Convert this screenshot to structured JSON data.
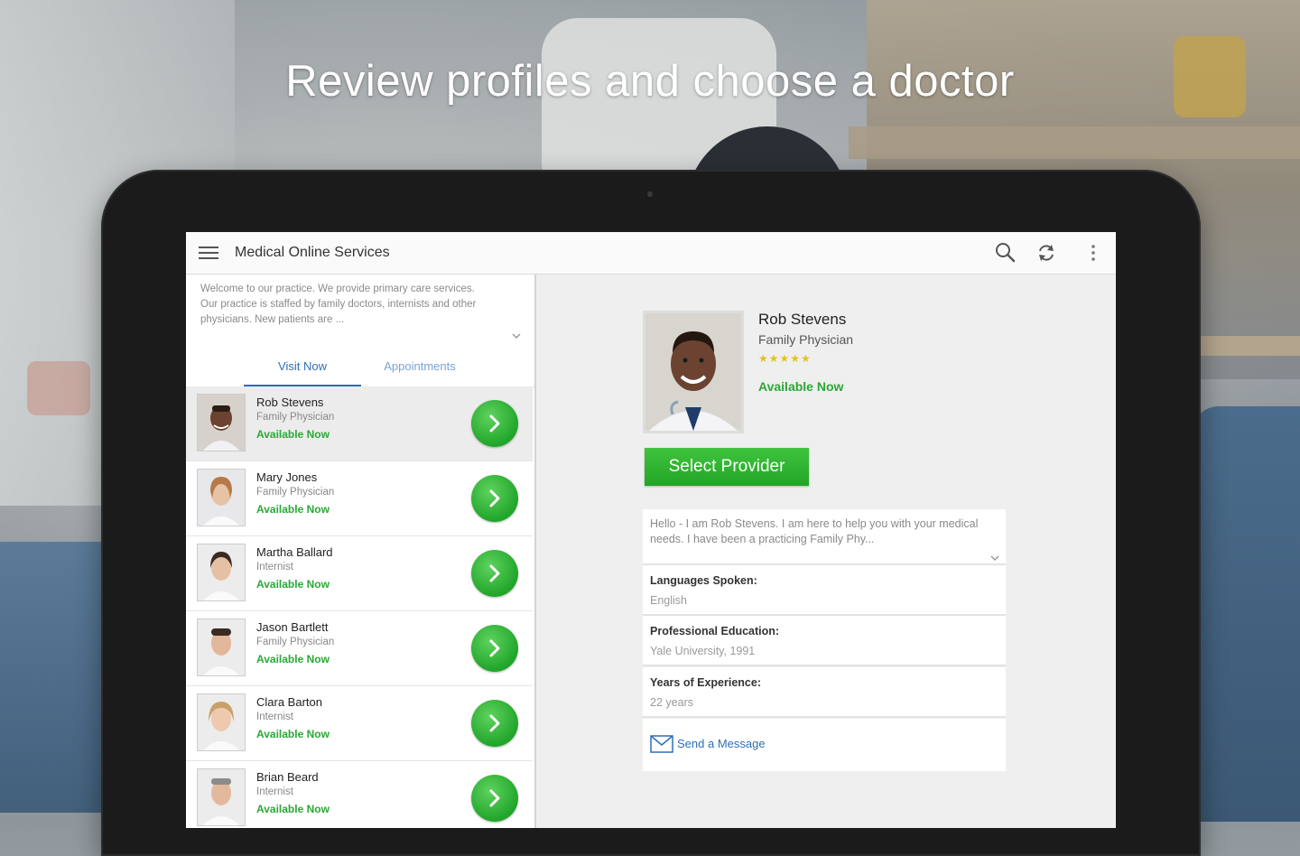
{
  "headline": "Review profiles and choose a doctor",
  "app": {
    "title": "Medical Online Services",
    "intro": "Welcome to our practice. We provide primary care services. Our practice is staffed by family doctors, internists and other physicians. New patients are ...",
    "tabs": [
      {
        "label": "Visit Now",
        "active": true
      },
      {
        "label": "Appointments",
        "active": false
      }
    ]
  },
  "doctors": [
    {
      "name": "Rob Stevens",
      "specialty": "Family Physician",
      "status": "Available Now",
      "selected": true
    },
    {
      "name": "Mary Jones",
      "specialty": "Family Physician",
      "status": "Available Now"
    },
    {
      "name": "Martha Ballard",
      "specialty": "Internist",
      "status": "Available Now"
    },
    {
      "name": "Jason Bartlett",
      "specialty": "Family Physician",
      "status": "Available Now"
    },
    {
      "name": "Clara Barton",
      "specialty": "Internist",
      "status": "Available Now"
    },
    {
      "name": "Brian Beard",
      "specialty": "Internist",
      "status": "Available Now"
    }
  ],
  "profile": {
    "name": "Rob Stevens",
    "specialty": "Family Physician",
    "rating": "★★★★★",
    "status": "Available Now",
    "select_label": "Select Provider",
    "bio": "Hello - I am Rob Stevens. I am here to help you with your medical needs. I have been a practicing Family Phy...",
    "languages_label": "Languages Spoken:",
    "languages_value": "English",
    "education_label": "Professional Education:",
    "education_value": "Yale University, 1991",
    "experience_label": "Years of Experience:",
    "experience_value": "22 years",
    "message_label": "Send a Message"
  },
  "colors": {
    "accent_blue": "#2d6fb7",
    "available_green": "#2aa836",
    "button_green": "#22a526"
  }
}
